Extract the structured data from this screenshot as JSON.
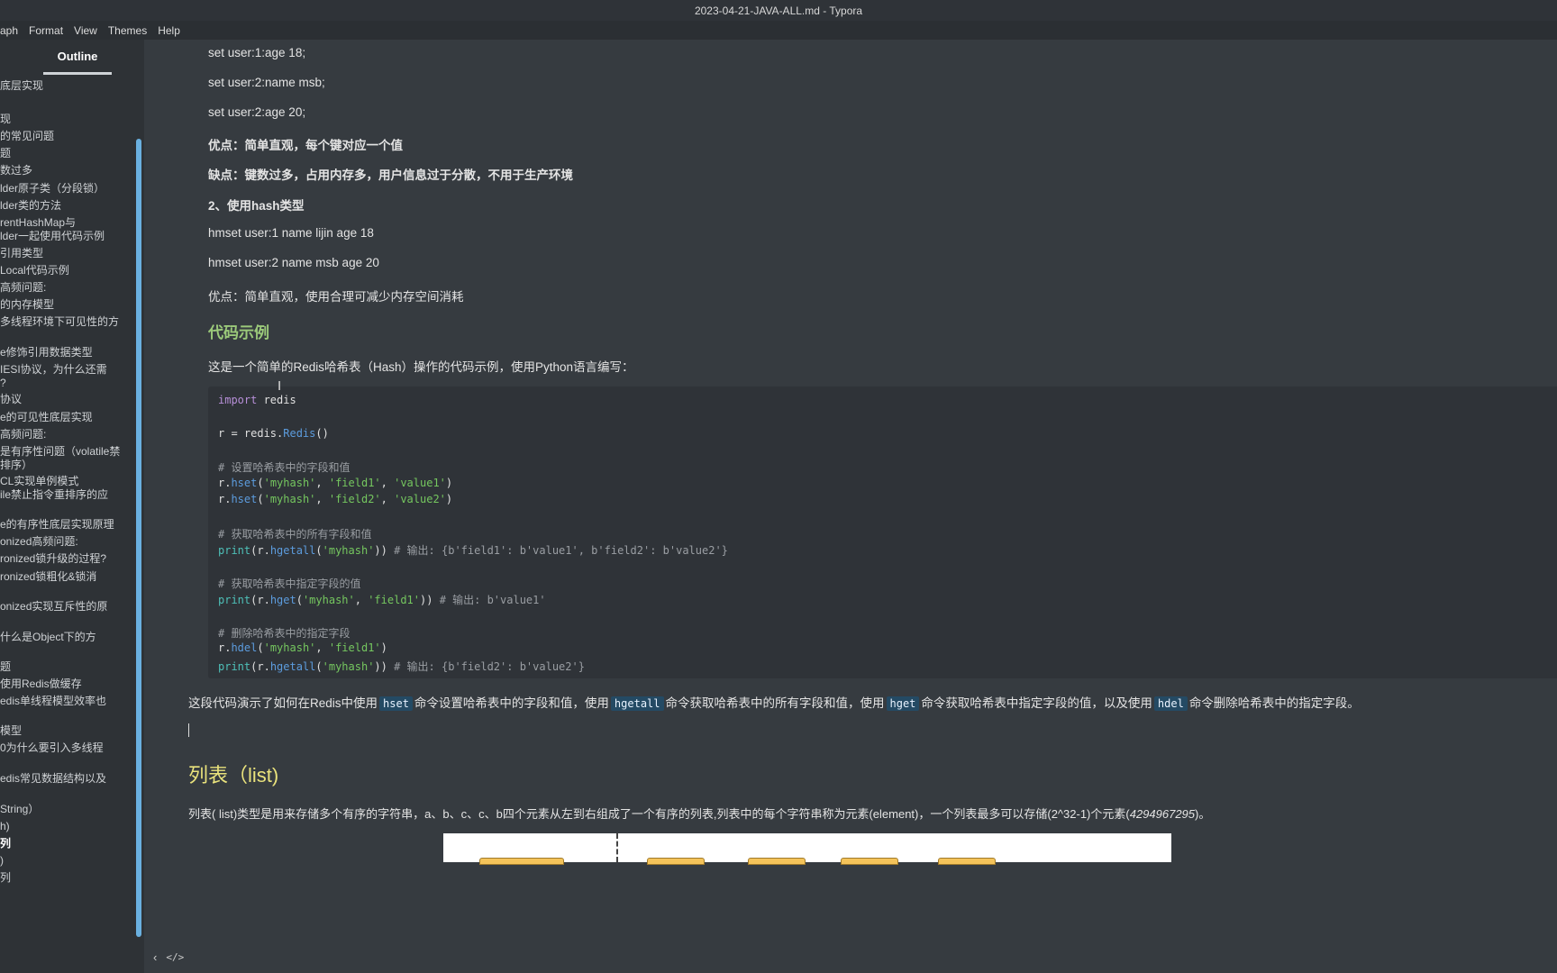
{
  "window": {
    "title": "2023-04-21-JAVA-ALL.md - Typora"
  },
  "menu": [
    "aph",
    "Format",
    "View",
    "Themes",
    "Help"
  ],
  "sidebar": {
    "tab": "Outline",
    "items": [
      "底层实现",
      "现",
      "的常见问题",
      "题",
      "数过多",
      "lder原子类（分段锁）",
      "lder类的方法",
      "rentHashMap与\nlder一起使用代码示例",
      "引用类型",
      "Local代码示例",
      "高频问题:",
      "的内存模型",
      "多线程环境下可见性的方",
      "e修饰引用数据类型",
      "IESI协议，为什么还需\n?",
      "协议",
      "e的可见性底层实现",
      "高频问题:",
      "是有序性问题（volatile禁\n排序）",
      "CL实现单例模式\nile禁止指令重排序的应",
      "e的有序性底层实现原理",
      "onized高频问题:",
      "ronized锁升级的过程?",
      "ronized锁粗化&锁消",
      "onized实现互斥性的原",
      "什么是Object下的方",
      "题",
      "使用Redis做缓存",
      "edis单线程模型效率也",
      "模型",
      "0为什么要引入多线程",
      "edis常见数据结构以及",
      "String）",
      "h)",
      "列",
      ")",
      "列"
    ],
    "active_item": "列",
    "footer": {
      "left_icon": "chevron-left-icon",
      "right_icon": "code-view-icon"
    }
  },
  "doc": {
    "line1": "set user:1:age  18;",
    "line2": "set user:2:name msb;",
    "line3": "set user:2:age  20;",
    "pros1": "优点：简单直观，每个键对应一个值",
    "cons1": "缺点：键数过多，占用内存多，用户信息过于分散，不用于生产环境",
    "sec2": "2、使用hash类型",
    "hm1": "hmset user:1 name lijin age 18",
    "hm2": "hmset user:2 name msb age 20",
    "pros2": "优点：简单直观，使用合理可减少内存空间消耗",
    "h_code": "代码示例",
    "intro": "这是一个简单的Redis哈希表（Hash）操作的代码示例，使用Python语言编写：",
    "code": {
      "l1_kw": "import",
      "l1_rest": " redis",
      "l2_a": "r = redis.",
      "l2_fn": "Redis",
      "l2_b": "()",
      "c1": "# 设置哈希表中的字段和值",
      "set1": {
        "pre": "r.",
        "fn": "hset",
        "a": "(",
        "s1": "'myhash'",
        "c": ", ",
        "s2": "'field1'",
        "d": ", ",
        "s3": "'value1'",
        "e": ")"
      },
      "set2": {
        "pre": "r.",
        "fn": "hset",
        "a": "(",
        "s1": "'myhash'",
        "c": ", ",
        "s2": "'field2'",
        "d": ", ",
        "s3": "'value2'",
        "e": ")"
      },
      "c2": "# 获取哈希表中的所有字段和值",
      "p1": {
        "pr": "print",
        "a": "(r.",
        "fn": "hgetall",
        "b": "(",
        "s1": "'myhash'",
        "c": ")) ",
        "cm": "# 输出: {b'field1': b'value1', b'field2': b'value2'}"
      },
      "c3": "# 获取哈希表中指定字段的值",
      "p2": {
        "pr": "print",
        "a": "(r.",
        "fn": "hget",
        "b": "(",
        "s1": "'myhash'",
        "c": ", ",
        "s2": "'field1'",
        "d": ")) ",
        "cm": "# 输出: b'value1'"
      },
      "c4": "# 删除哈希表中的指定字段",
      "del": {
        "pre": "r.",
        "fn": "hdel",
        "a": "(",
        "s1": "'myhash'",
        "c": ", ",
        "s2": "'field1'",
        "e": ")"
      },
      "p3": {
        "pr": "print",
        "a": "(r.",
        "fn": "hgetall",
        "b": "(",
        "s1": "'myhash'",
        "c": ")) ",
        "cm": "# 输出: {b'field2': b'value2'}"
      }
    },
    "summary": {
      "t1": "这段代码演示了如何在Redis中使用",
      "k1": "hset",
      "t2": "命令设置哈希表中的字段和值，使用",
      "k2": "hgetall",
      "t3": "命令获取哈希表中的所有字段和值，使用",
      "k3": "hget",
      "t4": "命令获取哈希表中指定字段的值，以及使用",
      "k4": "hdel",
      "t5": "命令删除哈希表中的指定字段。"
    },
    "h_list": "列表（list)",
    "list_para_a": "列表( list)类型是用来存储多个有序的字符串，a、b、c、c、b四个元素从左到右组成了一个有序的列表,列表中的每个字符串称为元素(element)，一个列表最多可以存储(2^32-1)个元素(",
    "list_para_em": "4294967295",
    "list_para_b": ")。"
  }
}
